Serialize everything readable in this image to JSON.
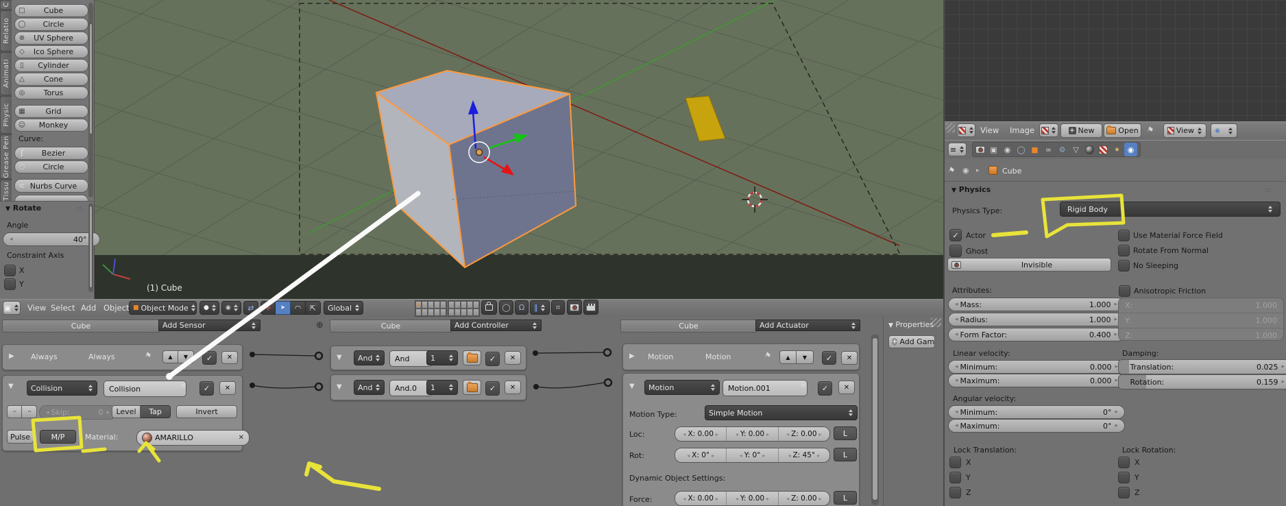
{
  "icons": {
    "check": "✓",
    "x": "✕",
    "tri_right": "▶",
    "tri_down": "▼",
    "up": "▲",
    "down": "▼",
    "plus": "+",
    "dots": "···",
    "grip": "::::",
    "expand": "⊕",
    "menu_lines": "≡",
    "crumb_arrow": "▸",
    "pin": "⚑",
    "circle": "◯",
    "magnet": "Ω",
    "snap_elem": "‖",
    "snap_grid": "⌗",
    "editor_cube": "▣",
    "manip_axis": "✛",
    "manip_move": "➤",
    "manip_rot": "◠",
    "manip_scale": "⇱",
    "widget_toggle": "⇄",
    "shade_sphere": "●",
    "pivot": "◉",
    "mode_cube": "■",
    "tool_cube": "□",
    "tool_circle": "◯",
    "tool_uv": "⊕",
    "tool_ico": "◇",
    "tool_cyl": "▯",
    "tool_cone": "△",
    "tool_torus": "◎",
    "tool_grid": "▦",
    "tool_monkey": "☺",
    "tool_bezier": "ʃ",
    "tool_ccurve": "◌",
    "tool_nurbs": "⊂",
    "tab_render": "◧",
    "tab_layers": "▣",
    "tab_scene": "◉",
    "tab_world": "◯",
    "tab_object": "■",
    "tab_constraint": "∞",
    "tab_modifier": "⚙",
    "tab_data": "▽",
    "tab_particles": "✶",
    "tab_phys": "◉",
    "scene_mini": "◉"
  },
  "toolshelf": {
    "tabs": [
      "C",
      "Relatio",
      "Animati",
      "Physic",
      "Grease Pen",
      "Tissu"
    ],
    "mesh_buttons": [
      "Cube",
      "Circle",
      "UV Sphere",
      "Ico Sphere",
      "Cylinder",
      "Cone",
      "Torus"
    ],
    "extra_buttons": [
      "Grid",
      "Monkey"
    ],
    "curve_label": "Curve:",
    "curve_buttons": [
      "Bezier",
      "Circle",
      "Nurbs Curve"
    ],
    "rotate_panel": {
      "title": "Rotate",
      "angle_label": "Angle",
      "angle_value": "40°",
      "constraint_label": "Constraint Axis",
      "axis_x": "X",
      "axis_y": "Y"
    }
  },
  "viewport": {
    "menus": [
      "View",
      "Select",
      "Add",
      "Object"
    ],
    "mode": "Object Mode",
    "orientation": "Global",
    "object_label": "(1) Cube"
  },
  "logic": {
    "sensors": {
      "owner": "Cube",
      "add": "Add Sensor",
      "always": {
        "type": "Always",
        "name": "Always"
      },
      "collision": {
        "type": "Collision",
        "name": "Collision",
        "skip_label": "Skip:",
        "skip_value": "0",
        "level": "Level",
        "tap": "Tap",
        "invert": "Invert",
        "pulse": "Pulse",
        "mp": "M/P",
        "material_label": "Material:",
        "material": "AMARILLO"
      }
    },
    "controllers": {
      "owner": "Cube",
      "add": "Add Controller",
      "items": [
        {
          "type": "And",
          "name": "And",
          "state": "1"
        },
        {
          "type": "And",
          "name": "And.0",
          "state": "1"
        }
      ]
    },
    "actuators": {
      "owner": "Cube",
      "add": "Add Actuator",
      "motion1": {
        "type": "Motion",
        "name": "Motion"
      },
      "motion2": {
        "type": "Motion",
        "name": "Motion.001",
        "motion_type_label": "Motion Type:",
        "motion_type": "Simple Motion",
        "loc_label": "Loc:",
        "rot_label": "Rot:",
        "dyn_label": "Dynamic Object Settings:",
        "force_label": "Force:",
        "loc": [
          "X: 0.00",
          "Y: 0.00",
          "Z: 0.00"
        ],
        "rot": [
          "X: 0°",
          "Y: 0°",
          "Z: 45°"
        ],
        "force": [
          "X: 0.00",
          "Y: 0.00",
          "Z: 0.00"
        ],
        "l": "L"
      }
    },
    "flyout": {
      "title": "Properties",
      "add_button": "Add Gam"
    }
  },
  "image_editor": {
    "menus": [
      "View",
      "Image"
    ],
    "new_button": "New",
    "open_button": "Open",
    "view_dropdown": "View"
  },
  "properties": {
    "breadcrumb": "Cube",
    "panel_title": "Physics",
    "physics_type_label": "Physics Type:",
    "physics_type": "Rigid Body",
    "actor": "Actor",
    "ghost": "Ghost",
    "invisible": "Invisible",
    "checks_right": [
      "Use Material Force Field",
      "Rotate From Normal",
      "No Sleeping"
    ],
    "attributes_label": "Attributes:",
    "sliders": [
      {
        "label": "Mass:",
        "value": "1.000"
      },
      {
        "label": "Radius:",
        "value": "1.000"
      },
      {
        "label": "Form Factor:",
        "value": "0.400"
      }
    ],
    "aniso": "Anisotropic Friction",
    "aniso_fields": [
      {
        "label": "X:",
        "value": "1.000"
      },
      {
        "label": "Y:",
        "value": "1.000"
      },
      {
        "label": "Z:",
        "value": "1.000"
      }
    ],
    "linvel_label": "Linear velocity:",
    "linvel": [
      {
        "label": "Minimum:",
        "value": "0.000"
      },
      {
        "label": "Maximum:",
        "value": "0.000"
      }
    ],
    "damping_label": "Damping:",
    "damping": [
      {
        "label": "Translation:",
        "value": "0.025"
      },
      {
        "label": "Rotation:",
        "value": "0.159"
      }
    ],
    "angvel_label": "Angular velocity:",
    "angvel": [
      {
        "label": "Minimum:",
        "value": "0°"
      },
      {
        "label": "Maximum:",
        "value": "0°"
      }
    ],
    "lock_t_label": "Lock Translation:",
    "lock_r_label": "Lock Rotation:",
    "axes": [
      "X",
      "Y",
      "Z"
    ]
  },
  "colors": {
    "annotation": "#e8e33a",
    "select_orange": "#ff9a3c",
    "active_blue": "#5680c2",
    "ground_green": "#66715b"
  }
}
